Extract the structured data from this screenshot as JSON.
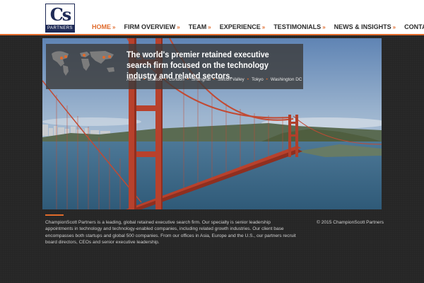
{
  "header": {
    "logo": {
      "mark": "Cs",
      "text": "PARTNERS"
    },
    "nav": [
      {
        "label": "HOME",
        "active": true
      },
      {
        "label": "FIRM OVERVIEW",
        "active": false
      },
      {
        "label": "TEAM",
        "active": false
      },
      {
        "label": "EXPERIENCE",
        "active": false
      },
      {
        "label": "TESTIMONIALS",
        "active": false
      },
      {
        "label": "NEWS & INSIGHTS",
        "active": false
      },
      {
        "label": "CONTACT",
        "active": false
      }
    ],
    "arrow": "»"
  },
  "hero": {
    "headline": "The world's premier retained executive search firm focused on the technology industry and related sectors.",
    "offices": [
      "Atlanta",
      "Boston",
      "London",
      "Shanghai",
      "Silicon Valley",
      "Tokyo",
      "Washington DC"
    ],
    "office_separator": "•",
    "icons": {
      "map": "world-map-icon"
    }
  },
  "footer": {
    "about": "ChampionScott Partners is a leading, global retained executive search firm. Our specialty is senior leadership appointments in technology and technology-enabled companies, including related growth industries. Our client base encompasses both startups and global 500 companies. From our offices in Asia, Europe and the U.S., our partners recruit board directors, CEOs and senior executive leadership.",
    "copyright": "© 2015 ChampionScott Partners"
  },
  "colors": {
    "accent": "#e06a2b",
    "brand_navy": "#1f2b57",
    "background": "#262626",
    "bridge": "#b8412c"
  }
}
